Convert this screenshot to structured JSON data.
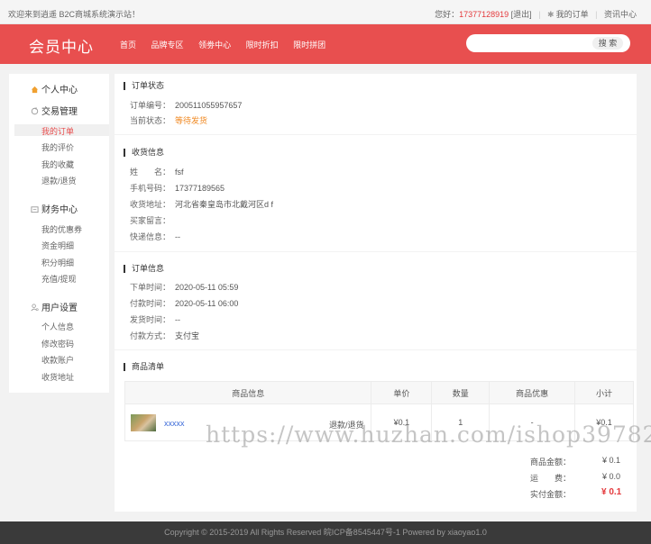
{
  "topbar": {
    "welcome": "欢迎来到逍遥 B2C商城系统演示站！",
    "greeting": "您好：",
    "phone": "17377128919",
    "logout": "[退出]",
    "my_orders": "我的订单",
    "news_center": "资讯中心"
  },
  "header": {
    "logo": "会员中心",
    "nav": [
      "首页",
      "品牌专区",
      "领劵中心",
      "限时折扣",
      "限时拼团"
    ],
    "search_placeholder": "",
    "search_button": "搜 索"
  },
  "sidebar": {
    "personal_center": "个人中心",
    "trade_group": "交易管理",
    "trade_items": [
      "我的订单",
      "我的评价",
      "我的收藏",
      "退款/退货"
    ],
    "finance_group": "财务中心",
    "finance_items": [
      "我的优惠券",
      "资金明细",
      "积分明细",
      "充值/提现"
    ],
    "user_group": "用户设置",
    "user_items": [
      "个人信息",
      "修改密码",
      "收款账户",
      "收货地址"
    ]
  },
  "order_status": {
    "title": "订单状态",
    "order_no_label": "订单编号：",
    "order_no": "200511055957657",
    "status_label": "当前状态：",
    "status": "等待发货"
  },
  "receiver": {
    "title": "收货信息",
    "name_label": "姓　　名：",
    "name": "fsf",
    "phone_label": "手机号码：",
    "phone": "17377189565",
    "address_label": "收货地址：",
    "address": "河北省秦皇岛市北戴河区d f",
    "message_label": "买家留言：",
    "message": "",
    "express_label": "快递信息：",
    "express": "--"
  },
  "order_info": {
    "title": "订单信息",
    "order_time_label": "下单时间：",
    "order_time": "2020-05-11 05:59",
    "pay_time_label": "付款时间：",
    "pay_time": "2020-05-11 06:00",
    "ship_time_label": "发货时间：",
    "ship_time": "--",
    "pay_method_label": "付款方式：",
    "pay_method": "支付宝"
  },
  "goods": {
    "title": "商品清单",
    "headers": [
      "商品信息",
      "单价",
      "数量",
      "商品优惠",
      "小计"
    ],
    "rows": [
      {
        "name": "xxxxx",
        "action": "退款/退货",
        "price": "¥0.1",
        "qty": "1",
        "discount": "-",
        "subtotal": "¥0.1"
      }
    ]
  },
  "summary": {
    "goods_amount_label": "商品金额：",
    "goods_amount": "¥ 0.1",
    "shipping_label": "运　　费：",
    "shipping": "¥ 0.0",
    "paid_label": "实付金额：",
    "paid": "¥ 0.1"
  },
  "footer": {
    "copyright": "Copyright © 2015-2019 All Rights Reserved 皖ICP备8545447号-1   Powered by xiaoyao1.0"
  },
  "watermark": "https://www.huzhan.com/ishop39782",
  "colors": {
    "brand": "#e84f4f",
    "status_orange": "#f08a24",
    "price_red": "#e4393c"
  }
}
